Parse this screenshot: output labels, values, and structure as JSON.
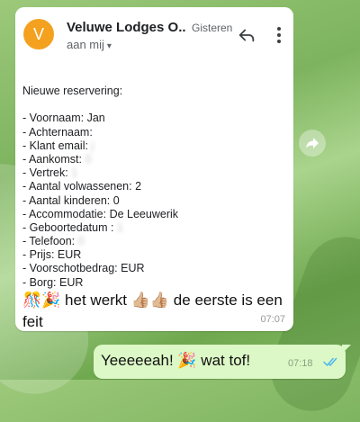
{
  "email": {
    "avatar_letter": "V",
    "avatar_color": "#f4a11f",
    "sender": "Veluwe Lodges O...",
    "date": "Gisteren",
    "recipient": "aan mij",
    "body": {
      "heading": "Nieuwe reservering:",
      "lines": [
        {
          "label": "- Voornaam: ",
          "value": "Jan",
          "hidden": ""
        },
        {
          "label": "- Achternaam:",
          "value": "",
          "hidden": ""
        },
        {
          "label": "- Klant email: ",
          "value": "",
          "hidden": "j"
        },
        {
          "label": "- Aankomst: ",
          "value": "",
          "hidden": "0"
        },
        {
          "label": "- Vertrek: ",
          "value": "",
          "hidden": "1"
        },
        {
          "label": "- Aantal volwassenen: ",
          "value": "2",
          "hidden": ""
        },
        {
          "label": "- Aantal kinderen: ",
          "value": "0",
          "hidden": ""
        },
        {
          "label": "- Accommodatie: ",
          "value": "De Leeuwerik",
          "hidden": ""
        },
        {
          "label": "- Geboortedatum : ",
          "value": "",
          "hidden": "1"
        },
        {
          "label": "- Telefoon: ",
          "value": "",
          "hidden": "0"
        },
        {
          "label": "- Prijs: ",
          "value": "EUR",
          "hidden": ""
        },
        {
          "label": "- Voorschotbedrag: ",
          "value": "EUR",
          "hidden": ""
        },
        {
          "label": "- Borg: ",
          "value": "EUR",
          "hidden": ""
        }
      ]
    }
  },
  "incoming_message": {
    "text": "🎊🎉 het werkt 👍🏼👍🏼 de eerste is een feit",
    "time": "07:07"
  },
  "outgoing_message": {
    "text": "Yeeeeeah! 🎉 wat tof!",
    "time": "07:18",
    "tick_color": "#4fb6ec"
  },
  "colors": {
    "outgoing_bubble": "#dcf8c6",
    "incoming_bubble": "#ffffff"
  }
}
